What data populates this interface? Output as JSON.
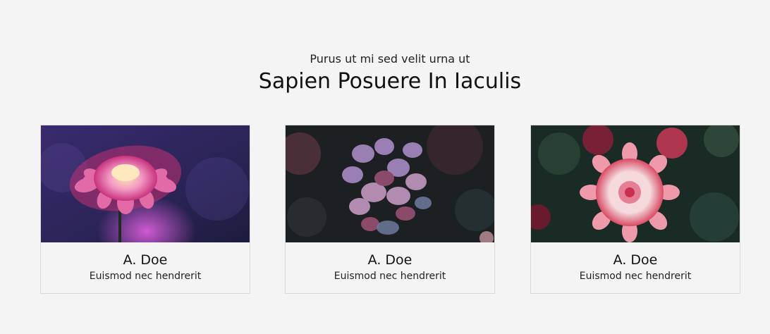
{
  "section": {
    "eyebrow": "Purus ut mi sed velit urna ut",
    "title": "Sapien Posuere In Iaculis"
  },
  "cards": [
    {
      "name": "A. Doe",
      "role": "Euismod nec hendrerit",
      "image_icon": "pink-dahlia-photo"
    },
    {
      "name": "A. Doe",
      "role": "Euismod nec hendrerit",
      "image_icon": "purple-hydrangea-photo"
    },
    {
      "name": "A. Doe",
      "role": "Euismod nec hendrerit",
      "image_icon": "red-white-dahlia-photo"
    }
  ],
  "colors": {
    "background": "#f4f4f4",
    "card_border": "#d9d9d9",
    "text": "#111111"
  }
}
